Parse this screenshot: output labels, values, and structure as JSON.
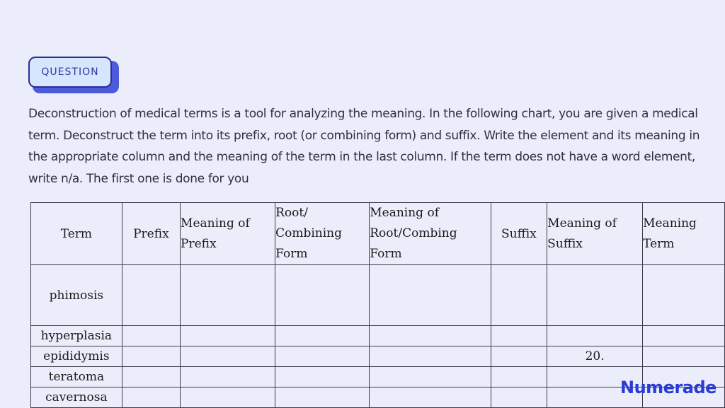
{
  "badge": {
    "label": "QUESTION"
  },
  "prompt": "Deconstruction of medical terms is a tool for analyzing the meaning. In the following chart, you are given a medical term. Deconstruct the term into its prefix, root (or combining form) and suffix. Write the element and its meaning in the appropriate column and the meaning of the term in the last column. If the term does not have a word element, write n/a. The first one is done for you",
  "table": {
    "headers": [
      "Term",
      "Prefix",
      "Meaning of Prefix",
      "Root/ Combining Form",
      "Meaning of Root/Combing Form",
      "Suffix",
      "Meaning of Suffix",
      "Meaning Term"
    ],
    "rows": [
      {
        "term": "phimosis",
        "cells": [
          "",
          "",
          "",
          "",
          "",
          "",
          ""
        ]
      },
      {
        "term": "hyperplasia",
        "cells": [
          "",
          "",
          "",
          "",
          "",
          "",
          ""
        ]
      },
      {
        "term": "epididymis",
        "cells": [
          "",
          "",
          "",
          "",
          "",
          "20.",
          ""
        ]
      },
      {
        "term": "teratoma",
        "cells": [
          "",
          "",
          "",
          "",
          "",
          "",
          ""
        ]
      },
      {
        "term": "cavernosa",
        "cells": [
          "",
          "",
          "",
          "",
          "",
          "",
          ""
        ]
      }
    ]
  },
  "brand": {
    "logo_text": "Numerade",
    "color": "#2b3bd6"
  }
}
